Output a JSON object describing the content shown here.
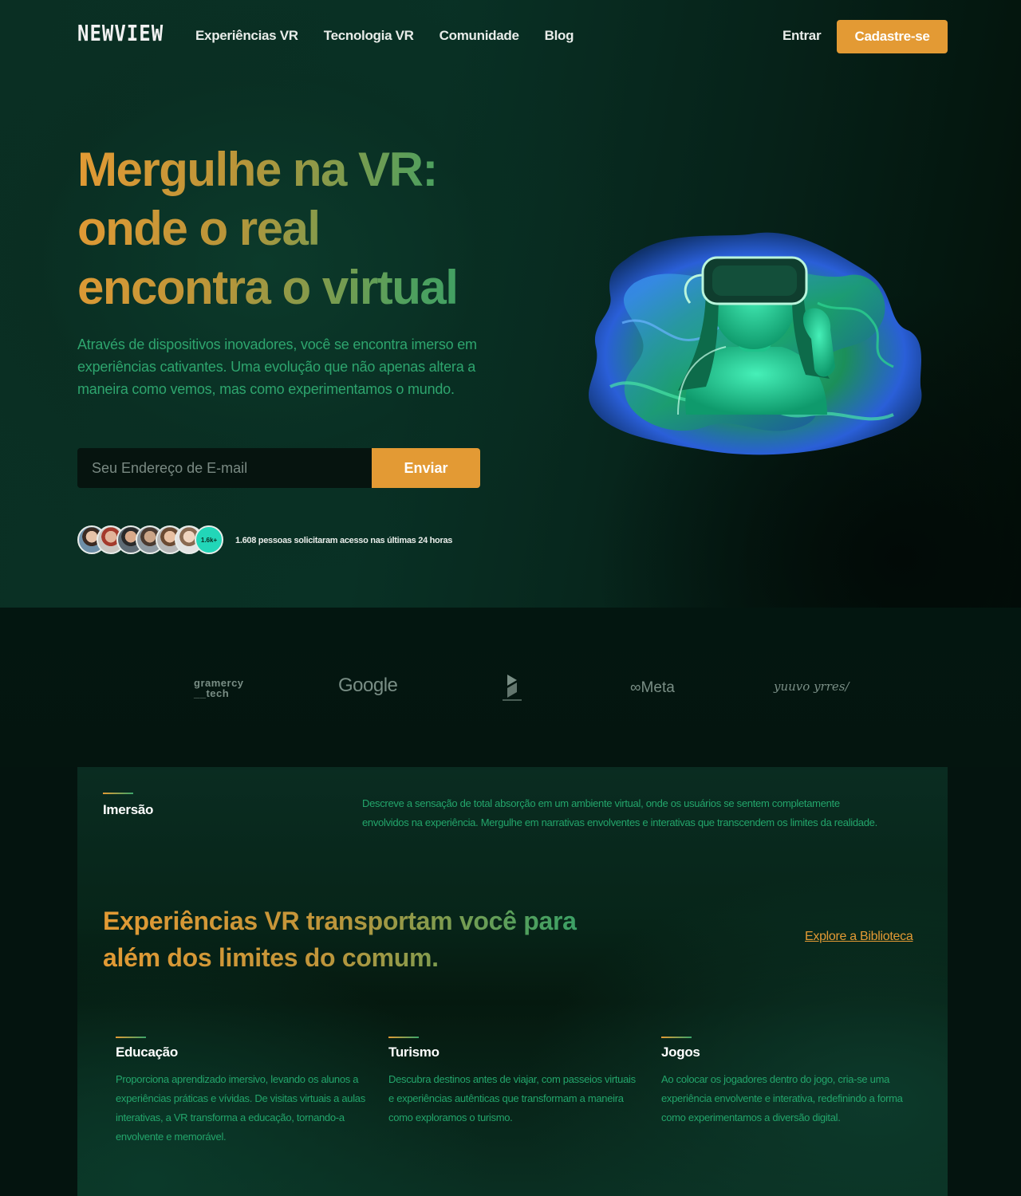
{
  "nav": {
    "logo": "NEWVIEW",
    "links": [
      "Experiências VR",
      "Tecnologia VR",
      "Comunidade",
      "Blog"
    ],
    "login": "Entrar",
    "signup": "Cadastre-se"
  },
  "hero": {
    "title_lines": [
      "Mergulhe na VR:",
      "onde o real",
      "encontra o virtual"
    ],
    "description": "Através de dispositivos inovadores, você se encontra imerso em experiências cativantes. Uma evolução que não apenas altera a maneira como vemos, mas como experimentamos o mundo.",
    "email_placeholder": "Seu Endereço de E-mail",
    "send_button": "Enviar",
    "avatar_count": "1.6k+",
    "proof_text": "1.608 pessoas solicitaram acesso nas últimas 24 horas"
  },
  "partners": {
    "gramercy_line1": "gramercy",
    "gramercy_line2": "__tech",
    "google": "Google",
    "meta": "Meta",
    "signature": "yuuvo yrres/"
  },
  "features": {
    "immersion_title": "Imersão",
    "immersion_desc": "Descreve a sensação de total absorção em um ambiente virtual, onde os usuários se sentem completamente envolvidos na experiência. Mergulhe em narrativas envolventes e interativas que transcendem os limites da realidade.",
    "section_title": "Experiências VR transportam você para além dos limites do comum.",
    "explore_link": "Explore a Biblioteca",
    "items": [
      {
        "title": "Educação",
        "desc": "Proporciona aprendizado imersivo, levando os alunos a experiências práticas e vívidas. De visitas virtuais a aulas interativas, a VR transforma a educação, tornando-a envolvente e memorável."
      },
      {
        "title": "Turismo",
        "desc": "Descubra destinos antes de viajar, com passeios virtuais e experiências autênticas que transformam a maneira como exploramos o turismo."
      },
      {
        "title": "Jogos",
        "desc": "Ao colocar os jogadores dentro do jogo, cria-se uma experiência envolvente e interativa, redefinindo a forma como experimentamos a diversão digital."
      }
    ]
  },
  "colors": {
    "accent_orange": "#e39a34",
    "accent_green": "#23a56b",
    "hero_bg": "#0a2f23",
    "page_bg": "#04140f"
  },
  "icons": [
    "vr-headset-illustration",
    "fourth-partner-logo-icon",
    "meta-infinity-icon"
  ]
}
